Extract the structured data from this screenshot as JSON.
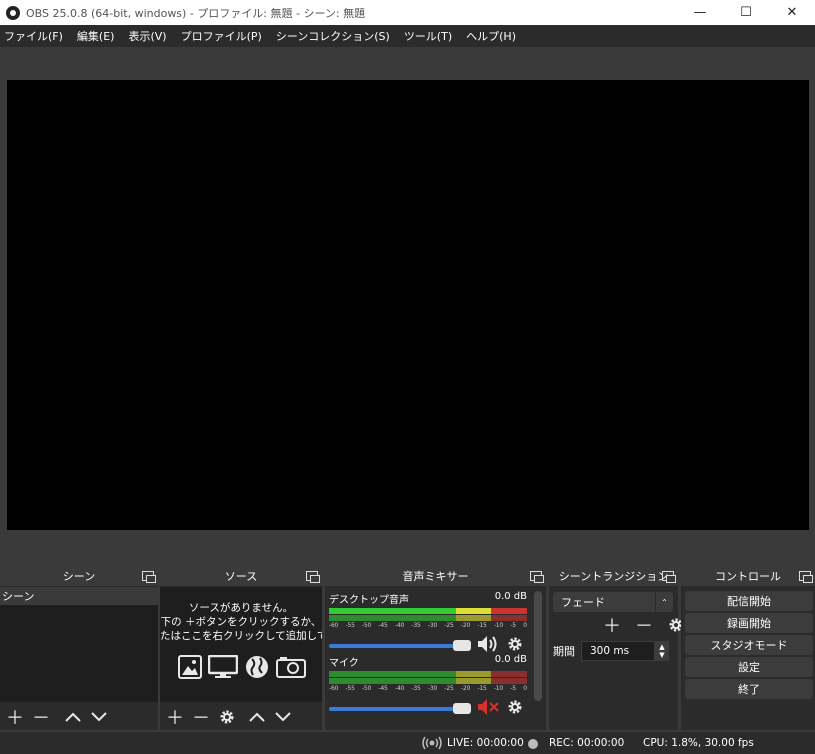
{
  "window": {
    "title": "OBS 25.0.8 (64-bit, windows) - プロファイル: 無題 - シーン: 無題",
    "minimize_label": "—",
    "maximize_label": "☐",
    "close_label": "✕"
  },
  "menu": [
    "ファイル(F)",
    "編集(E)",
    "表示(V)",
    "プロファイル(P)",
    "シーンコレクション(S)",
    "ツール(T)",
    "ヘルプ(H)"
  ],
  "docks": {
    "scenes": {
      "title": "シーン",
      "items": [
        "シーン"
      ]
    },
    "sources": {
      "title": "ソース",
      "empty_line1": "ソースがありません。",
      "empty_line2": "下の ＋ボタンをクリックするか、",
      "empty_line3": "たはここを右クリックして追加してくださ"
    },
    "mixer": {
      "title": "音声ミキサー",
      "channels": [
        {
          "name": "デスクトップ音声",
          "level": "0.0 dB",
          "muted": false
        },
        {
          "name": "マイク",
          "level": "0.0 dB",
          "muted": true
        }
      ],
      "ticks": [
        "-60",
        "-55",
        "-50",
        "-45",
        "-40",
        "-35",
        "-30",
        "-25",
        "-20",
        "-15",
        "-10",
        "-5",
        "0"
      ]
    },
    "transitions": {
      "title": "シーントランジション",
      "selected": "フェード",
      "duration_label": "期間",
      "duration_value": "300 ms"
    },
    "controls": {
      "title": "コントロール",
      "buttons": [
        "配信開始",
        "録画開始",
        "スタジオモード",
        "設定",
        "終了"
      ]
    }
  },
  "status": {
    "live": "LIVE: 00:00:00",
    "rec": "REC: 00:00:00",
    "cpu": "CPU: 1.8%, 30.00 fps"
  },
  "colors": {
    "background": "#3a3a3a",
    "dock": "#2b2b2b",
    "fader_accent": "#3a7bd5",
    "mute_red": "#d9302c"
  }
}
